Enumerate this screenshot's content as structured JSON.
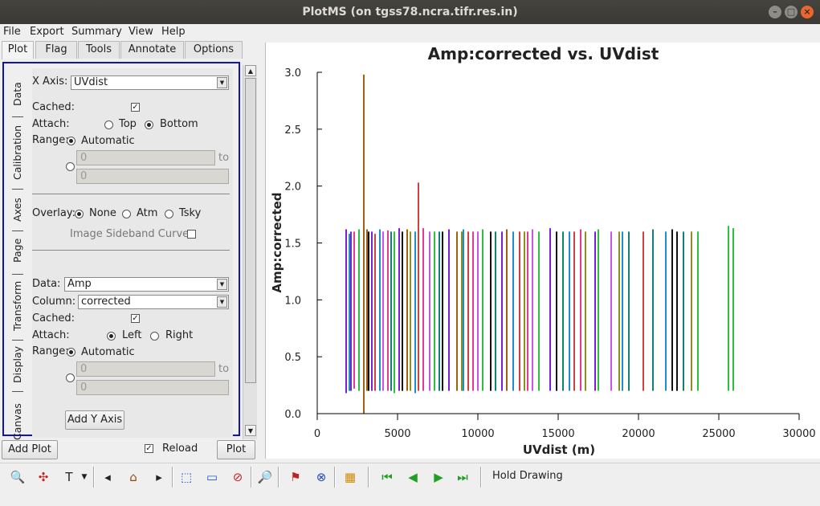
{
  "window": {
    "title": "PlotMS (on tgss78.ncra.tifr.res.in)"
  },
  "menu": [
    "File",
    "Export",
    "Summary",
    "View",
    "Help"
  ],
  "tabs": [
    "Plot",
    "Flag",
    "Tools",
    "Annotate",
    "Options"
  ],
  "vtabs": [
    "Data",
    "Calibration",
    "Axes",
    "Page",
    "Transform",
    "Display",
    "Canvas"
  ],
  "xaxis": {
    "label": "X Axis:",
    "value": "UVdist",
    "cached_label": "Cached:",
    "attach_label": "Attach:",
    "attach_top": "Top",
    "attach_bottom": "Bottom",
    "range_label": "Range:",
    "automatic": "Automatic",
    "range_min": "0",
    "range_max": "0",
    "to": "to"
  },
  "overlay": {
    "label": "Overlay:",
    "none": "None",
    "atm": "Atm",
    "tsky": "Tsky",
    "sideband": "Image Sideband Curve:"
  },
  "yaxis": {
    "data_label": "Data:",
    "data_value": "Amp",
    "column_label": "Column:",
    "column_value": "corrected",
    "cached_label": "Cached:",
    "attach_label": "Attach:",
    "attach_left": "Left",
    "attach_right": "Right",
    "range_label": "Range:",
    "automatic": "Automatic",
    "range_min": "0",
    "range_max": "0",
    "to": "to",
    "add_y_axis": "Add Y Axis"
  },
  "bottom": {
    "add_plot": "Add Plot",
    "reload": "Reload",
    "plot": "Plot"
  },
  "toolbar": {
    "hold_drawing": "Hold Drawing"
  },
  "chart_data": {
    "type": "scatter",
    "title": "Amp:corrected vs. UVdist",
    "xlabel": "UVdist (m)",
    "ylabel": "Amp:corrected",
    "xlim": [
      0,
      30000
    ],
    "ylim": [
      0,
      3.0
    ],
    "xticks": [
      "0",
      "5000",
      "10000",
      "15000",
      "20000",
      "25000",
      "30000"
    ],
    "yticks": [
      "0.0",
      "0.5",
      "1.0",
      "1.5",
      "2.0",
      "2.5",
      "3.0"
    ],
    "series": [
      {
        "color": "#7a1fd6",
        "values": [
          [
            1800,
            0.18,
            1.62
          ],
          [
            2100,
            0.2,
            1.6
          ],
          [
            3400,
            0.2,
            1.6
          ],
          [
            5100,
            0.2,
            1.63
          ],
          [
            8200,
            0.2,
            1.62
          ],
          [
            11500,
            0.2,
            1.6
          ],
          [
            14500,
            0.2,
            1.63
          ],
          [
            17300,
            0.2,
            1.6
          ]
        ]
      },
      {
        "color": "#1f8ecf",
        "values": [
          [
            2000,
            0.2,
            1.58
          ],
          [
            3900,
            0.2,
            1.62
          ],
          [
            6100,
            0.18,
            1.6
          ],
          [
            9100,
            0.2,
            1.62
          ],
          [
            12200,
            0.2,
            1.6
          ],
          [
            15700,
            0.2,
            1.6
          ],
          [
            19000,
            0.2,
            1.6
          ],
          [
            21700,
            0.2,
            1.6
          ]
        ]
      },
      {
        "color": "#e73a8e",
        "values": [
          [
            2300,
            0.22,
            1.6
          ],
          [
            4400,
            0.2,
            1.61
          ],
          [
            6600,
            0.2,
            1.63
          ],
          [
            9700,
            0.2,
            1.6
          ],
          [
            13100,
            0.2,
            1.6
          ],
          [
            16400,
            0.2,
            1.62
          ]
        ]
      },
      {
        "color": "#2fbf3f",
        "values": [
          [
            2600,
            0.2,
            1.62
          ],
          [
            4800,
            0.18,
            1.6
          ],
          [
            7300,
            0.2,
            1.6
          ],
          [
            10300,
            0.2,
            1.62
          ],
          [
            13800,
            0.2,
            1.6
          ],
          [
            17500,
            0.2,
            1.62
          ],
          [
            23700,
            0.2,
            1.6
          ],
          [
            25600,
            0.2,
            1.65
          ],
          [
            25900,
            0.2,
            1.63
          ]
        ]
      },
      {
        "color": "#a06010",
        "values": [
          [
            2900,
            0.0,
            2.98
          ],
          [
            3100,
            0.2,
            1.62
          ],
          [
            5600,
            0.2,
            1.62
          ],
          [
            8700,
            0.2,
            1.6
          ],
          [
            11800,
            0.2,
            1.62
          ]
        ]
      },
      {
        "color": "#111111",
        "values": [
          [
            3200,
            0.2,
            1.6
          ],
          [
            5300,
            0.2,
            1.6
          ],
          [
            7800,
            0.2,
            1.6
          ],
          [
            10800,
            0.2,
            1.6
          ],
          [
            14900,
            0.2,
            1.6
          ],
          [
            22100,
            0.2,
            1.62
          ],
          [
            22400,
            0.2,
            1.6
          ]
        ]
      },
      {
        "color": "#d04040",
        "values": [
          [
            3600,
            0.2,
            1.58
          ],
          [
            6300,
            0.2,
            2.03
          ],
          [
            9400,
            0.2,
            1.6
          ],
          [
            12600,
            0.2,
            1.6
          ],
          [
            16000,
            0.2,
            1.6
          ],
          [
            20300,
            0.2,
            1.6
          ]
        ]
      },
      {
        "color": "#cc55e8",
        "values": [
          [
            4100,
            0.2,
            1.6
          ],
          [
            7000,
            0.2,
            1.6
          ],
          [
            10000,
            0.2,
            1.6
          ],
          [
            13400,
            0.2,
            1.62
          ],
          [
            18300,
            0.2,
            1.6
          ]
        ]
      },
      {
        "color": "#108070",
        "values": [
          [
            4600,
            0.2,
            1.6
          ],
          [
            7600,
            0.2,
            1.6
          ],
          [
            11100,
            0.2,
            1.6
          ],
          [
            15300,
            0.2,
            1.6
          ],
          [
            19400,
            0.2,
            1.6
          ],
          [
            20900,
            0.2,
            1.62
          ],
          [
            22800,
            0.2,
            1.6
          ]
        ]
      },
      {
        "color": "#8a8f22",
        "values": [
          [
            5800,
            0.2,
            1.6
          ],
          [
            9000,
            0.2,
            1.6
          ],
          [
            12900,
            0.2,
            1.6
          ],
          [
            16700,
            0.2,
            1.6
          ],
          [
            18800,
            0.2,
            1.6
          ],
          [
            23300,
            0.2,
            1.6
          ]
        ]
      }
    ]
  }
}
